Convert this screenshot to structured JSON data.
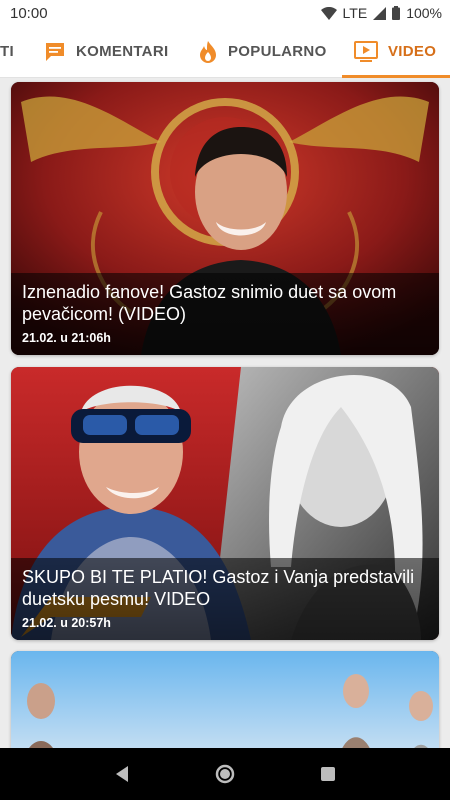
{
  "status_bar": {
    "time": "10:00",
    "network": "LTE",
    "battery": "100%"
  },
  "tabs": [
    {
      "label": "TI",
      "icon": "none",
      "active": false
    },
    {
      "label": "KOMENTARI",
      "icon": "comment-icon",
      "active": false
    },
    {
      "label": "POPULARNO",
      "icon": "flame-icon",
      "active": false
    },
    {
      "label": "VIDEO",
      "icon": "video-play-icon",
      "active": true
    }
  ],
  "colors": {
    "accent": "#f08c2a",
    "active_tab_text": "#d66f19",
    "inactive_tab_text": "#555555"
  },
  "feed": {
    "items": [
      {
        "title": "Iznenadio fanove! Gastoz snimio duet sa ovom pevačicom! (VIDEO)",
        "time": "21.02. u 21:06h"
      },
      {
        "title": "SKUPO BI TE PLATIO! Gastoz i Vanja predstavili duetsku pesmu! VIDEO",
        "time": "21.02. u 20:57h"
      }
    ]
  },
  "nav_bar": {
    "buttons": [
      "back-icon",
      "home-icon",
      "recents-icon"
    ]
  }
}
